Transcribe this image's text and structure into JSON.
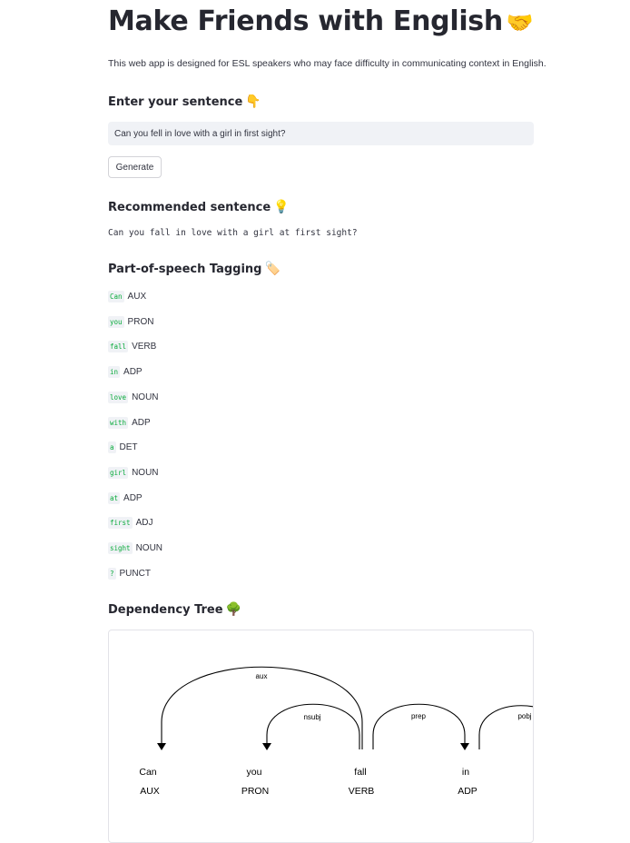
{
  "app": {
    "title": "Make Friends with English",
    "title_emoji": "🤝",
    "description": "This web app is designed for ESL speakers who may face difficulty in communicating context in English."
  },
  "input_section": {
    "heading": "Enter your sentence",
    "heading_emoji": "👇",
    "input_value": "Can you fell in love with a girl in first sight?",
    "generate_label": "Generate"
  },
  "recommend_section": {
    "heading": "Recommended sentence",
    "heading_emoji": "💡",
    "sentence": "Can you fall in love with a girl at first sight?"
  },
  "pos_section": {
    "heading": "Part-of-speech Tagging",
    "heading_emoji": "🏷️",
    "tokens": [
      {
        "word": "Can",
        "tag": "AUX"
      },
      {
        "word": "you",
        "tag": "PRON"
      },
      {
        "word": "fall",
        "tag": "VERB"
      },
      {
        "word": "in",
        "tag": "ADP"
      },
      {
        "word": "love",
        "tag": "NOUN"
      },
      {
        "word": "with",
        "tag": "ADP"
      },
      {
        "word": "a",
        "tag": "DET"
      },
      {
        "word": "girl",
        "tag": "NOUN"
      },
      {
        "word": "at",
        "tag": "ADP"
      },
      {
        "word": "first",
        "tag": "ADJ"
      },
      {
        "word": "sight",
        "tag": "NOUN"
      },
      {
        "word": "?",
        "tag": "PUNCT"
      }
    ]
  },
  "dependency_section": {
    "heading": "Dependency Tree",
    "heading_emoji": "🌳",
    "words": [
      {
        "text": "Can",
        "tag": "AUX"
      },
      {
        "text": "you",
        "tag": "PRON"
      },
      {
        "text": "fall",
        "tag": "VERB"
      },
      {
        "text": "in",
        "tag": "ADP"
      }
    ],
    "arcs": [
      {
        "label": "aux",
        "from": 2,
        "to": 0
      },
      {
        "label": "nsubj",
        "from": 2,
        "to": 1
      },
      {
        "label": "prep",
        "from": 2,
        "to": 3
      },
      {
        "label": "pobj",
        "from": 3,
        "to": 4
      }
    ]
  }
}
